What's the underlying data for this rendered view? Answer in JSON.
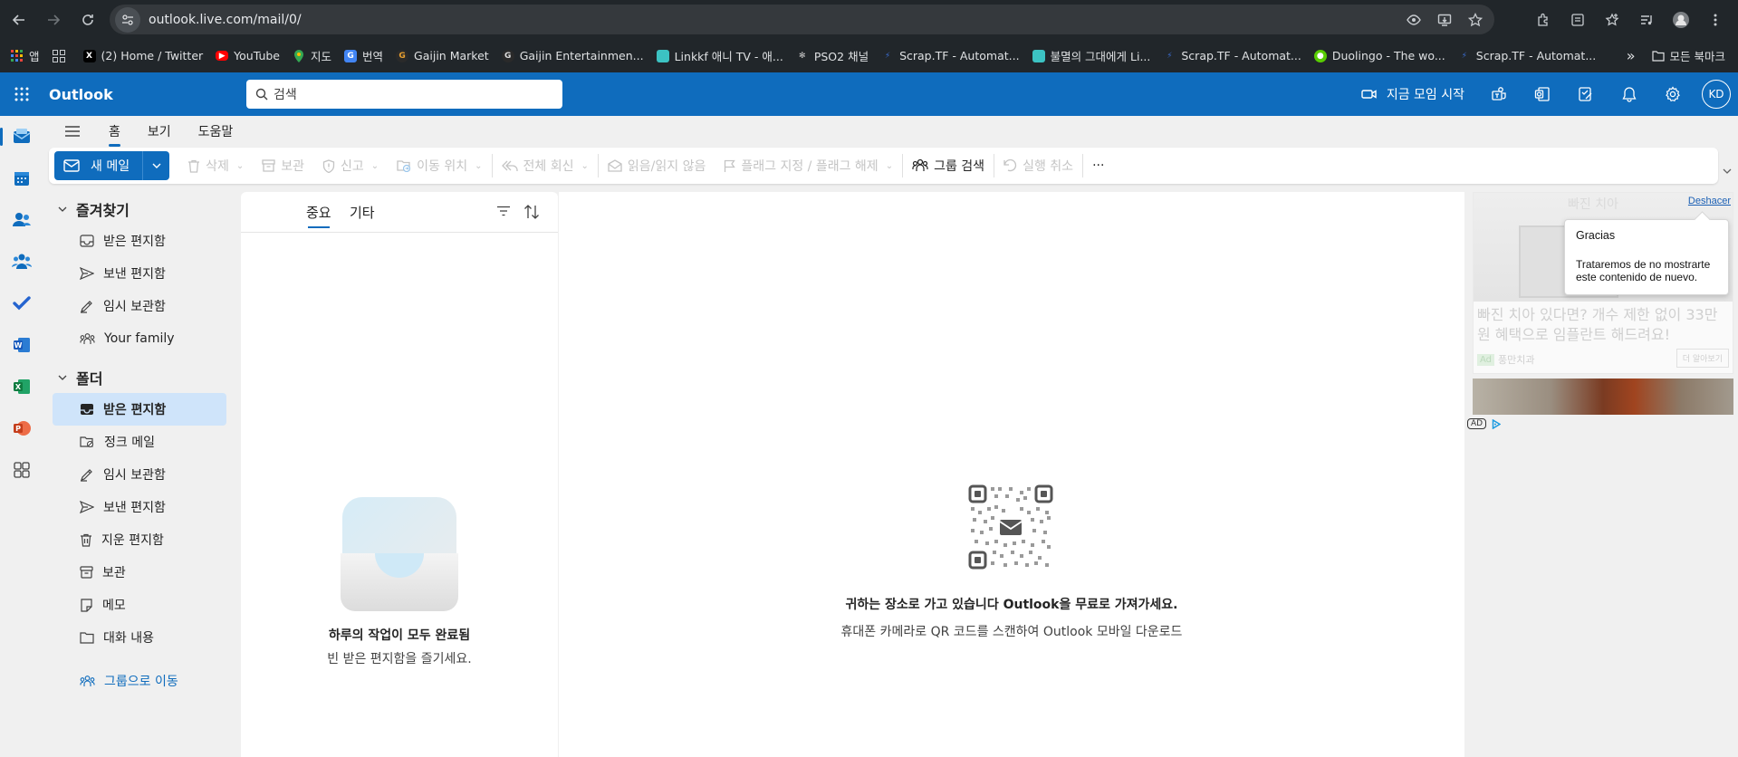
{
  "browser": {
    "url": "outlook.live.com/mail/0/",
    "bookmarks": [
      {
        "label": "앱",
        "icon": "apps-grid-icon",
        "color": "#e8453c"
      },
      {
        "label": "",
        "icon": "tab-groups-icon",
        "color": "#9aa0a6"
      },
      {
        "label": "(2) Home / Twitter",
        "icon": "x-logo-icon",
        "color": "#000000"
      },
      {
        "label": "YouTube",
        "icon": "youtube-icon",
        "color": "#ff0000"
      },
      {
        "label": "지도",
        "icon": "maps-icon",
        "color": "#34a853"
      },
      {
        "label": "번역",
        "icon": "translate-icon",
        "color": "#4285f4"
      },
      {
        "label": "Gaijin Market",
        "icon": "gaijin-icon",
        "color": "#333333"
      },
      {
        "label": "Gaijin Entertainmen...",
        "icon": "gaijin-icon",
        "color": "#333333"
      },
      {
        "label": "Linkkf 애니 TV - 애...",
        "icon": "linkkf-icon",
        "color": "#3cc3c3"
      },
      {
        "label": "PSO2 채널",
        "icon": "pso2-icon",
        "color": "#555555"
      },
      {
        "label": "Scrap.TF - Automat...",
        "icon": "scraptf-icon",
        "color": "#3b6fd6"
      },
      {
        "label": "불멸의 그대에게 Li...",
        "icon": "linkkf-icon",
        "color": "#3cc3c3"
      },
      {
        "label": "Scrap.TF - Automat...",
        "icon": "scraptf-icon",
        "color": "#3b6fd6"
      },
      {
        "label": "Duolingo - The wo...",
        "icon": "duolingo-icon",
        "color": "#58cc02"
      },
      {
        "label": "Scrap.TF - Automat...",
        "icon": "scraptf-icon",
        "color": "#3b6fd6"
      }
    ],
    "bookmarks_overflow": "»",
    "all_bookmarks": "모든 북마크"
  },
  "header": {
    "app_name": "Outlook",
    "search_placeholder": "검색",
    "meet_now": "지금 모임 시작",
    "avatar_initials": "KD"
  },
  "ribbon": {
    "tabs": [
      "홈",
      "보기",
      "도움말"
    ],
    "new_mail": "새 메일",
    "actions": {
      "delete": "삭제",
      "archive": "보관",
      "report": "신고",
      "move": "이동 위치",
      "reply_all": "전체 회신",
      "read_unread": "읽음/읽지 않음",
      "flag": "플래그 지정 / 플래그 해제",
      "group_search": "그룹 검색",
      "undo": "실행 취소",
      "more": "···"
    }
  },
  "folders": {
    "favorites_title": "즐겨찾기",
    "favorites": [
      "받은 편지함",
      "보낸 편지함",
      "임시 보관함",
      "Your family"
    ],
    "folders_title": "폴더",
    "items": [
      "받은 편지함",
      "정크 메일",
      "임시 보관함",
      "보낸 편지함",
      "지운 편지함",
      "보관",
      "메모",
      "대화 내용"
    ],
    "go_to_groups": "그룹으로 이동"
  },
  "message_list": {
    "tab_focused": "중요",
    "tab_other": "기타",
    "empty_title": "하루의 작업이 모두 완료됨",
    "empty_subtitle": "빈 받은 편지함을 즐기세요."
  },
  "reading_pane": {
    "promo_title": "귀하는 장소로 가고 있습니다 Outlook을 무료로 가져가세요.",
    "promo_subtitle": "휴대폰 카메라로 QR 코드를 스캔하여 Outlook 모바일 다운로드"
  },
  "ad": {
    "undo_link": "Deshacer",
    "tooltip_title": "Gracias",
    "tooltip_body": "Trataremos de no mostrarte este contenido de nuevo.",
    "text": "빠진 치아 있다면? 개수 제한 없이 33만원 혜택으로 임플란트 해드려요!",
    "image_caption": "빠진 치아",
    "source_badge": "Ad",
    "source": "풍만치과",
    "more_button": "더 알아보기",
    "adchoices": "AD"
  },
  "colors": {
    "brand": "#0f6cbd",
    "selected": "#cfe4fa"
  }
}
